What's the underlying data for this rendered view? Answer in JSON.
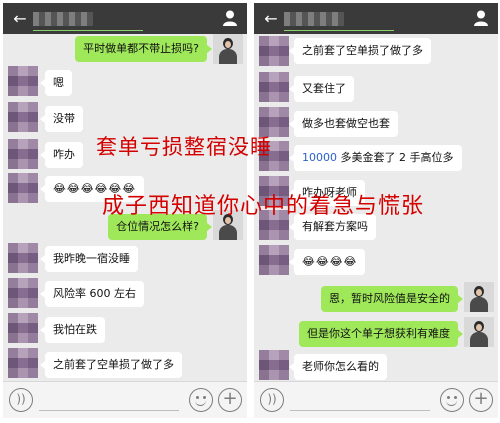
{
  "left_phone": {
    "header": {
      "back_icon": "back-arrow-icon",
      "user_icon": "user-icon"
    },
    "messages": [
      {
        "side": "out",
        "text": "平时做单都不带止损吗?"
      },
      {
        "side": "in",
        "text": "嗯"
      },
      {
        "side": "in",
        "text": "没带"
      },
      {
        "side": "in",
        "text": "咋办"
      },
      {
        "side": "in",
        "text": "😂😂😂😂😂😂"
      },
      {
        "side": "out",
        "text": "仓位情况怎么样?"
      },
      {
        "side": "in",
        "text": "我昨晚一宿没睡"
      },
      {
        "side": "in",
        "text": "风险率 600 左右"
      },
      {
        "side": "in",
        "text": "我怕在跌"
      },
      {
        "side": "in",
        "text": "之前套了空单损了做了多"
      }
    ],
    "footer": {
      "voice_icon": "voice-icon",
      "emoji_icon": "emoji-icon",
      "plus_icon": "plus-icon"
    }
  },
  "right_phone": {
    "header": {
      "back_icon": "back-arrow-icon",
      "user_icon": "user-icon"
    },
    "messages": [
      {
        "side": "in",
        "text": "之前套了空单损了做了多"
      },
      {
        "side": "in",
        "text": "又套住了"
      },
      {
        "side": "in",
        "text": "做多也套做空也套"
      },
      {
        "side": "in",
        "text_blue": "10000",
        "text": " 多美金套了 2 手高位多"
      },
      {
        "side": "in",
        "text": "咋办呀老师"
      },
      {
        "side": "in",
        "text": "有解套方案吗"
      },
      {
        "side": "in",
        "text": "😂😂😂😂"
      },
      {
        "side": "out",
        "text": "恩，暂时风险值是安全的"
      },
      {
        "side": "out",
        "text": "但是你这个单子想获利有难度"
      },
      {
        "side": "in",
        "text": "老师你怎么看的"
      }
    ],
    "footer": {
      "voice_icon": "voice-icon",
      "emoji_icon": "emoji-icon",
      "plus_icon": "plus-icon"
    }
  },
  "overlay": {
    "line1": "套单亏损整宿没睡",
    "line2": "成子西知道你心中的着急与慌张"
  },
  "colors": {
    "header_bg": "#3a3a3a",
    "chat_bg": "#ebebeb",
    "outgoing_bubble": "#9fe85a",
    "incoming_bubble": "#ffffff",
    "overlay_text": "#d40000"
  }
}
